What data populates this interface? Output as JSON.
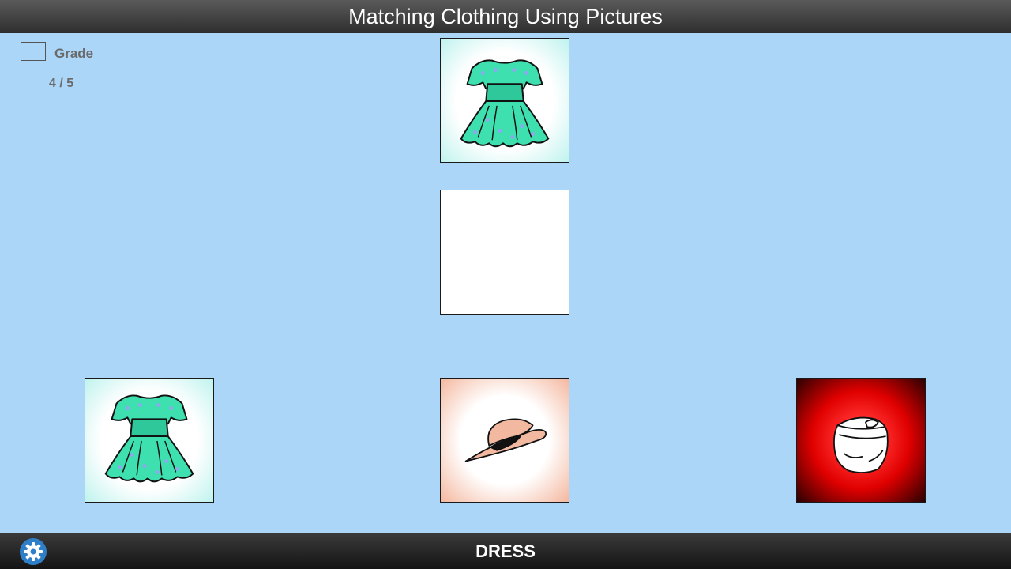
{
  "header": {
    "title": "Matching Clothing Using Pictures"
  },
  "grade": {
    "label": "Grade",
    "score": "4 / 5"
  },
  "prompt": {
    "target_icon": "dress-icon"
  },
  "options": [
    {
      "icon": "dress-icon"
    },
    {
      "icon": "hat-icon"
    },
    {
      "icon": "diaper-icon"
    }
  ],
  "footer": {
    "word": "DRESS",
    "settings_icon": "gear-icon"
  },
  "colors": {
    "background": "#acd6f8",
    "dress": "#3fe0b0",
    "hat": "#f2b8a0",
    "diaper_card": "#e00000",
    "settings": "#2f7fc8"
  }
}
